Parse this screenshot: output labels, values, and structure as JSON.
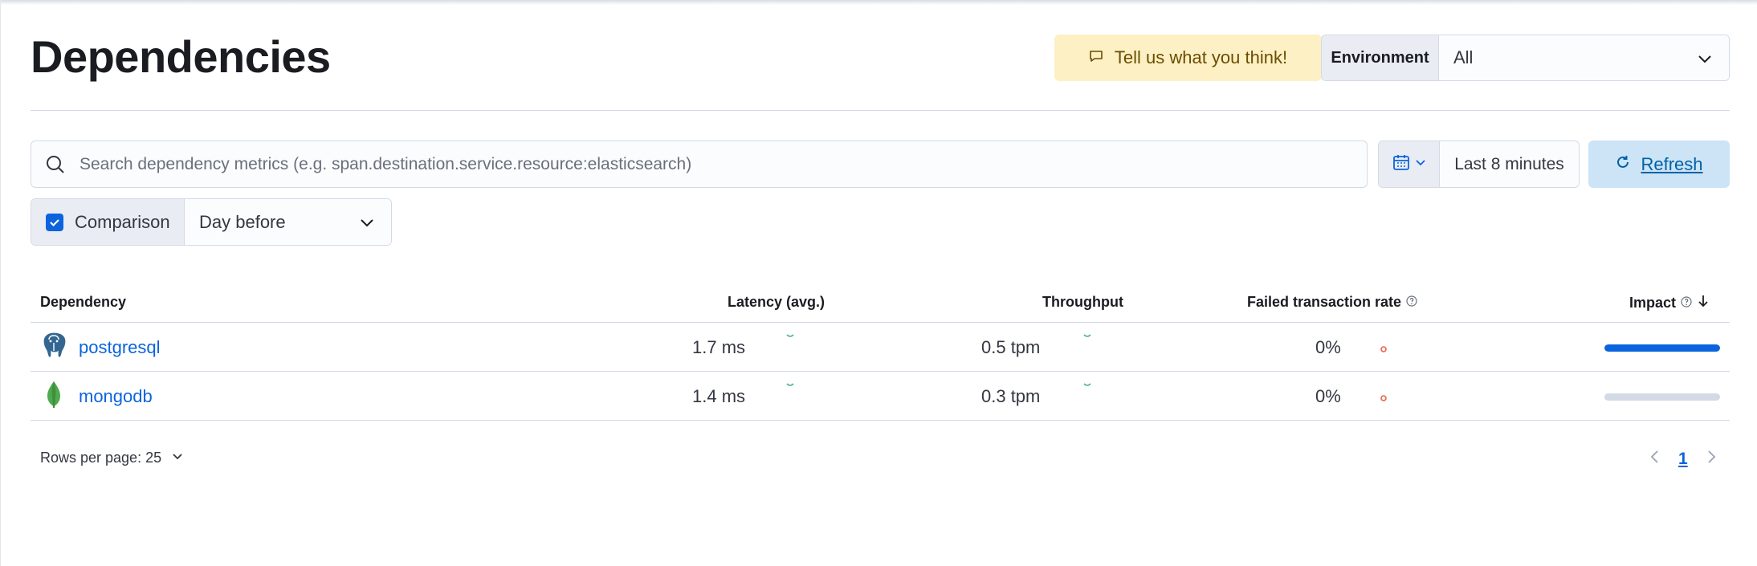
{
  "header": {
    "title": "Dependencies",
    "feedback_label": "Tell us what you think!",
    "environment": {
      "label": "Environment",
      "value": "All"
    }
  },
  "search": {
    "placeholder": "Search dependency metrics (e.g. span.destination.service.resource:elasticsearch)",
    "value": ""
  },
  "date_picker": {
    "value": "Last 8 minutes"
  },
  "refresh": {
    "label": "Refresh"
  },
  "comparison": {
    "label": "Comparison",
    "checked": true,
    "value": "Day before"
  },
  "table": {
    "columns": {
      "dependency": "Dependency",
      "latency": "Latency (avg.)",
      "throughput": "Throughput",
      "failed_rate": "Failed transaction rate",
      "impact": "Impact"
    },
    "rows": [
      {
        "name": "postgresql",
        "icon": "postgresql-icon",
        "latency": "1.7 ms",
        "throughput": "0.5 tpm",
        "failed_rate": "0%",
        "impact": 1.0
      },
      {
        "name": "mongodb",
        "icon": "mongodb-icon",
        "latency": "1.4 ms",
        "throughput": "0.3 tpm",
        "failed_rate": "0%",
        "impact": 0.0
      }
    ]
  },
  "pagination": {
    "rows_per_page_label": "Rows per page: 25",
    "current_page": "1"
  },
  "colors": {
    "accent": "#0b64dd",
    "refresh_bg": "#cce4f5",
    "feedback_bg": "#fdf0c5",
    "sparkline_teal": "#54b399",
    "failure_dot": "#e7664c"
  }
}
